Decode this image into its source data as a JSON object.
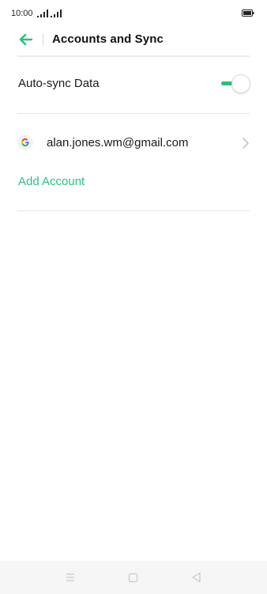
{
  "status_bar": {
    "time": "10:00"
  },
  "header": {
    "title": "Accounts and Sync",
    "back_icon": "arrow-left-icon"
  },
  "settings": {
    "auto_sync": {
      "label": "Auto-sync Data",
      "enabled": true
    }
  },
  "accounts": {
    "items": [
      {
        "provider_icon": "google-icon",
        "email": "alan.jones.wm@gmail.com",
        "chevron_icon": "chevron-right-icon"
      }
    ],
    "add_label": "Add Account"
  },
  "nav_bar": {
    "icons": [
      "menu-icon",
      "home-square-icon",
      "back-triangle-icon"
    ]
  },
  "colors": {
    "accent": "#2bbf7e",
    "text": "#1a1a1a",
    "divider": "#e6e6e6",
    "nav_background": "#f6f6f6",
    "chevron": "#c4c4c4"
  }
}
